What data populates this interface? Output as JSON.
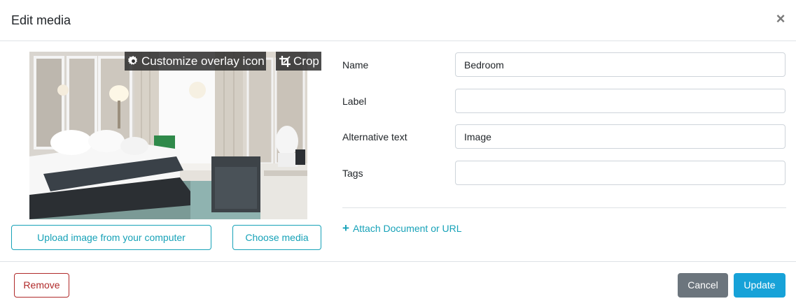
{
  "modal": {
    "title": "Edit media",
    "close_icon": "close-icon"
  },
  "image": {
    "customize_label": "Customize overlay icon",
    "customize_icon": "gear-icon",
    "crop_label": "Crop",
    "crop_icon": "crop-icon",
    "upload_label": "Upload image from your computer",
    "choose_label": "Choose media"
  },
  "form": {
    "fields": [
      {
        "label": "Name",
        "value": "Bedroom"
      },
      {
        "label": "Label",
        "value": ""
      },
      {
        "label": "Alternative text",
        "value": "Image"
      },
      {
        "label": "Tags",
        "value": ""
      }
    ],
    "attach_label": "Attach Document or URL",
    "attach_icon": "plus-icon"
  },
  "footer": {
    "remove_label": "Remove",
    "cancel_label": "Cancel",
    "update_label": "Update"
  },
  "colors": {
    "accent": "#17a2b8",
    "primary": "#17a2d8",
    "danger": "#b02a2a",
    "secondary": "#6c757d"
  }
}
